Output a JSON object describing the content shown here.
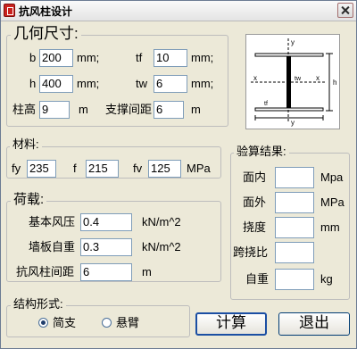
{
  "window": {
    "title": "抗风柱设计"
  },
  "geometry": {
    "title": "几何尺寸:",
    "b": {
      "label": "b",
      "value": "200",
      "unit": "mm;"
    },
    "tf": {
      "label": "tf",
      "value": "10",
      "unit": "mm;"
    },
    "h": {
      "label": "h",
      "value": "400",
      "unit": "mm;"
    },
    "tw": {
      "label": "tw",
      "value": "6",
      "unit": "mm;"
    },
    "column_height": {
      "label": "柱高",
      "value": "9",
      "unit": "m"
    },
    "support_spacing": {
      "label": "支撑间距",
      "value": "6",
      "unit": "m"
    }
  },
  "material": {
    "title": "材料:",
    "fy": {
      "label": "fy",
      "value": "235"
    },
    "f": {
      "label": "f",
      "value": "215"
    },
    "fv": {
      "label": "fv",
      "value": "125"
    },
    "unit": "MPa"
  },
  "load": {
    "title": "荷载:",
    "wind_pressure": {
      "label": "基本风压",
      "value": "0.4",
      "unit": "kN/m^2"
    },
    "wall_weight": {
      "label": "墙板自重",
      "value": "0.3",
      "unit": "kN/m^2"
    },
    "column_spacing": {
      "label": "抗风柱间距",
      "value": "6",
      "unit": "m"
    }
  },
  "structure": {
    "title": "结构形式:",
    "options": [
      {
        "label": "简支",
        "selected": true
      },
      {
        "label": "悬臂",
        "selected": false
      }
    ]
  },
  "results": {
    "title": "验算结果:",
    "in_plane": {
      "label": "面内",
      "value": "",
      "unit": "Mpa"
    },
    "out_of_plane": {
      "label": "面外",
      "value": "",
      "unit": "MPa"
    },
    "deflection": {
      "label": "挠度",
      "value": "",
      "unit": "mm"
    },
    "span_ratio": {
      "label": "跨挠比",
      "value": ""
    },
    "self_weight": {
      "label": "自重",
      "value": "",
      "unit": "kg"
    }
  },
  "diagram": {
    "labels": [
      "y",
      "x",
      "tw",
      "tf",
      "y",
      "x",
      "h"
    ]
  },
  "buttons": {
    "calculate": "计算",
    "exit": "退出"
  },
  "colors": {
    "title_text": "#000000",
    "field_border": "#7f9db9",
    "window_bg": "#ece9d8",
    "group_border": "#bdbdbd",
    "button_border": "#003c74"
  }
}
